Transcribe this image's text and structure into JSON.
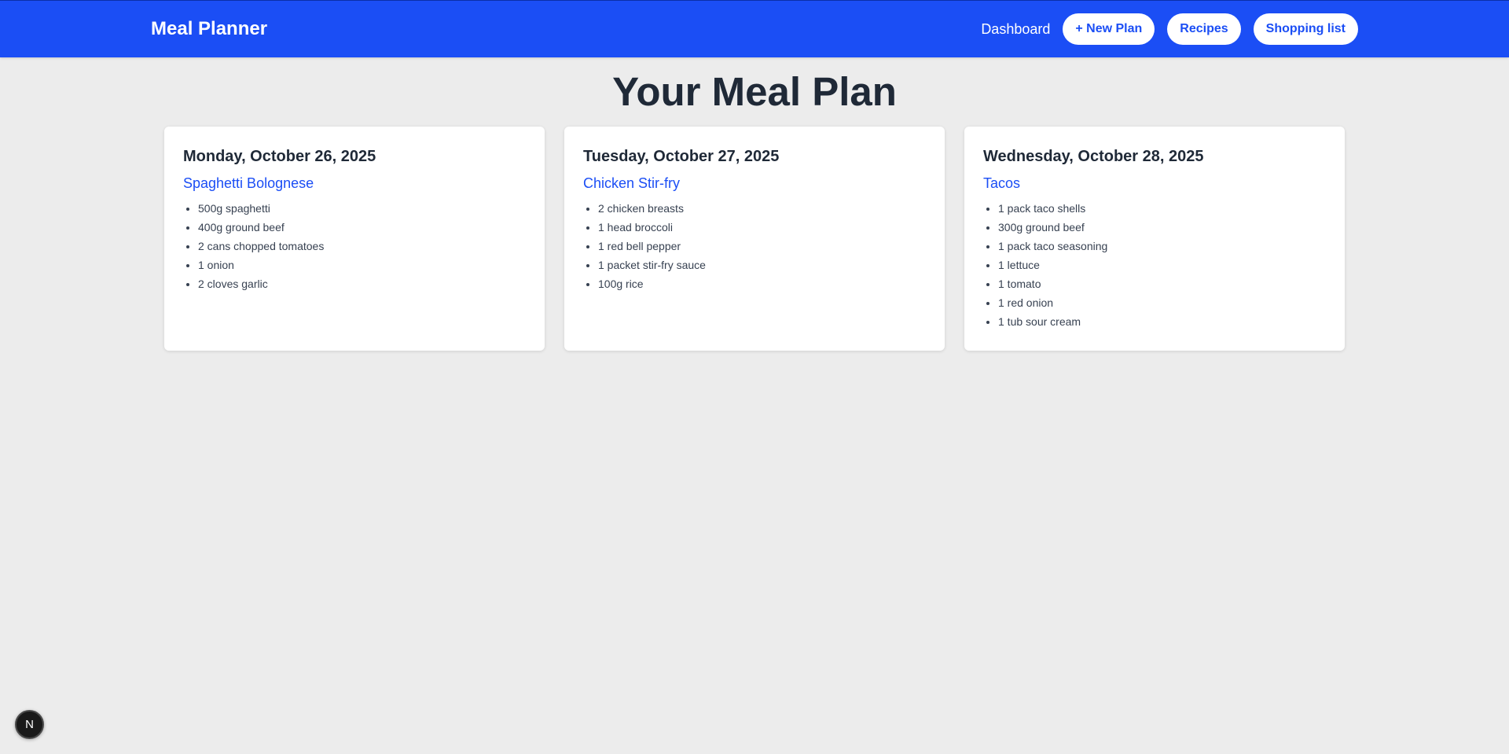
{
  "nav": {
    "brand": "Meal Planner",
    "dashboard_label": "Dashboard",
    "new_plan_label": "+ New Plan",
    "recipes_label": "Recipes",
    "shopping_list_label": "Shopping list"
  },
  "page": {
    "title": "Your Meal Plan"
  },
  "plans": [
    {
      "date": "Monday, October 26, 2025",
      "recipe": "Spaghetti Bolognese",
      "ingredients": [
        "500g spaghetti",
        "400g ground beef",
        "2 cans chopped tomatoes",
        "1 onion",
        "2 cloves garlic"
      ]
    },
    {
      "date": "Tuesday, October 27, 2025",
      "recipe": "Chicken Stir-fry",
      "ingredients": [
        "2 chicken breasts",
        "1 head broccoli",
        "1 red bell pepper",
        "1 packet stir-fry sauce",
        "100g rice"
      ]
    },
    {
      "date": "Wednesday, October 28, 2025",
      "recipe": "Tacos",
      "ingredients": [
        "1 pack taco shells",
        "300g ground beef",
        "1 pack taco seasoning",
        "1 lettuce",
        "1 tomato",
        "1 red onion",
        "1 tub sour cream"
      ]
    }
  ],
  "dev_badge": {
    "letter": "N"
  },
  "colors": {
    "accent": "#1b4ef5",
    "background": "#ececec",
    "card": "#ffffff"
  }
}
